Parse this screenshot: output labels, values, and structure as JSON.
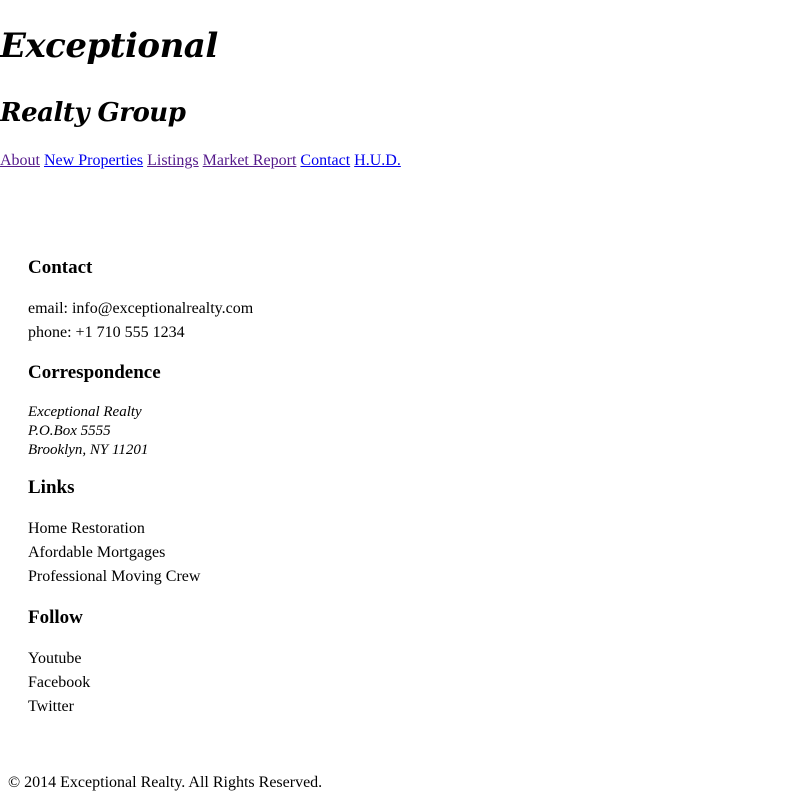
{
  "brand": {
    "line1": "Exceptional",
    "line2": "Realty Group"
  },
  "nav": {
    "items": [
      {
        "label": "About",
        "visited": true
      },
      {
        "label": "New Properties",
        "visited": false
      },
      {
        "label": "Listings",
        "visited": true
      },
      {
        "label": "Market Report",
        "visited": true
      },
      {
        "label": "Contact",
        "visited": false
      },
      {
        "label": "H.U.D.",
        "visited": false
      }
    ]
  },
  "contact": {
    "heading": "Contact",
    "email": "email: info@exceptionalrealty.com",
    "phone": "phone: +1 710 555 1234"
  },
  "correspondence": {
    "heading": "Correspondence",
    "name": "Exceptional Realty",
    "pobox": "P.O.Box 5555",
    "city": "Brooklyn, NY 11201"
  },
  "links": {
    "heading": "Links",
    "items": [
      "Home Restoration",
      "Afordable Mortgages",
      "Professional Moving Crew"
    ]
  },
  "follow": {
    "heading": "Follow",
    "items": [
      "Youtube",
      "Facebook",
      "Twitter"
    ]
  },
  "footer": {
    "text": "© 2014 Exceptional Realty. All Rights Reserved."
  }
}
